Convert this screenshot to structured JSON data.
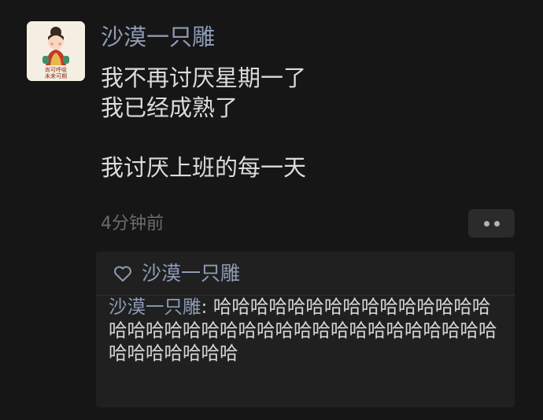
{
  "post": {
    "avatar": {
      "caption_line1": "尚可呼吸",
      "caption_line2": "未来可期",
      "icon": "cartoon-girl-avatar"
    },
    "author": "沙漠一只雕",
    "lines": [
      "我不再讨厌星期一了",
      "我已经成熟了",
      "",
      "我讨厌上班的每一天"
    ],
    "time": "4分钟前",
    "more_icon": "two-dots-icon"
  },
  "likes": {
    "icon": "heart-outline-icon",
    "names": "沙漠一只雕"
  },
  "comments": [
    {
      "user": "沙漠一只雕",
      "separator": ": ",
      "text": "哈哈哈哈哈哈哈哈哈哈哈哈哈哈哈哈哈哈哈哈哈哈哈哈哈哈哈哈哈哈哈哈哈哈哈哈哈哈哈哈哈哈哈"
    }
  ],
  "colors": {
    "background": "#161616",
    "name_link": "#8e9bb5",
    "body_text": "#dcdcdc",
    "muted_text": "#6c6c6c",
    "panel": "#202020"
  }
}
